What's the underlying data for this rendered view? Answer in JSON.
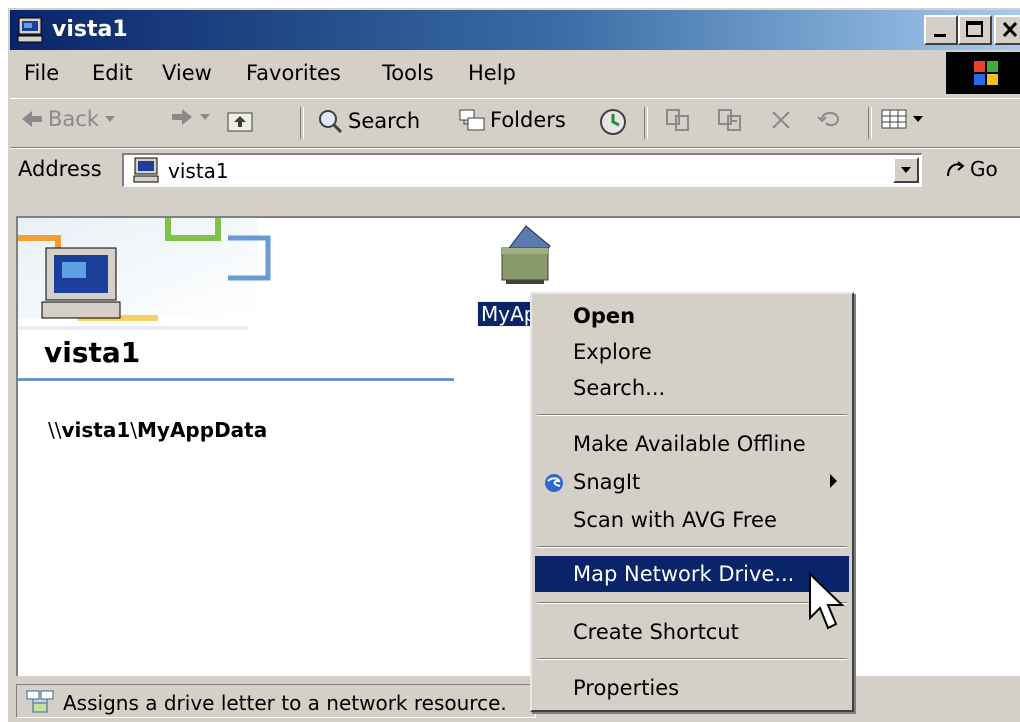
{
  "window": {
    "title": "vista1",
    "controls": [
      "minimize",
      "maximize",
      "close"
    ]
  },
  "menubar": {
    "items": [
      "File",
      "Edit",
      "View",
      "Favorites",
      "Tools",
      "Help"
    ]
  },
  "toolbar": {
    "back_label": "Back",
    "search_label": "Search",
    "folders_label": "Folders"
  },
  "address": {
    "label": "Address",
    "value": "vista1",
    "go_label": "Go"
  },
  "content": {
    "heading": "vista1",
    "unc_prefix": "\\\\",
    "unc_server": "vista1",
    "unc_sep": "\\",
    "unc_share": "MyAppData",
    "share_label": "MyAp"
  },
  "status": {
    "text": "Assigns a drive letter to a network resource."
  },
  "context_menu": {
    "items": [
      {
        "label": "Open",
        "bold": true
      },
      {
        "label": "Explore"
      },
      {
        "label": "Search..."
      },
      {
        "label": "Make Available Offline"
      },
      {
        "label": "SnagIt",
        "icon": "snagit-icon",
        "submenu": true
      },
      {
        "label": "Scan with AVG Free"
      },
      {
        "label": "Map Network Drive...",
        "highlighted": true
      },
      {
        "label": "Create Shortcut"
      },
      {
        "label": "Properties"
      }
    ]
  },
  "colors": {
    "titlebar_start": "#0a246a",
    "titlebar_end": "#a6caf0",
    "menu_highlight": "#0a246a",
    "window_face": "#d4d0c8"
  }
}
